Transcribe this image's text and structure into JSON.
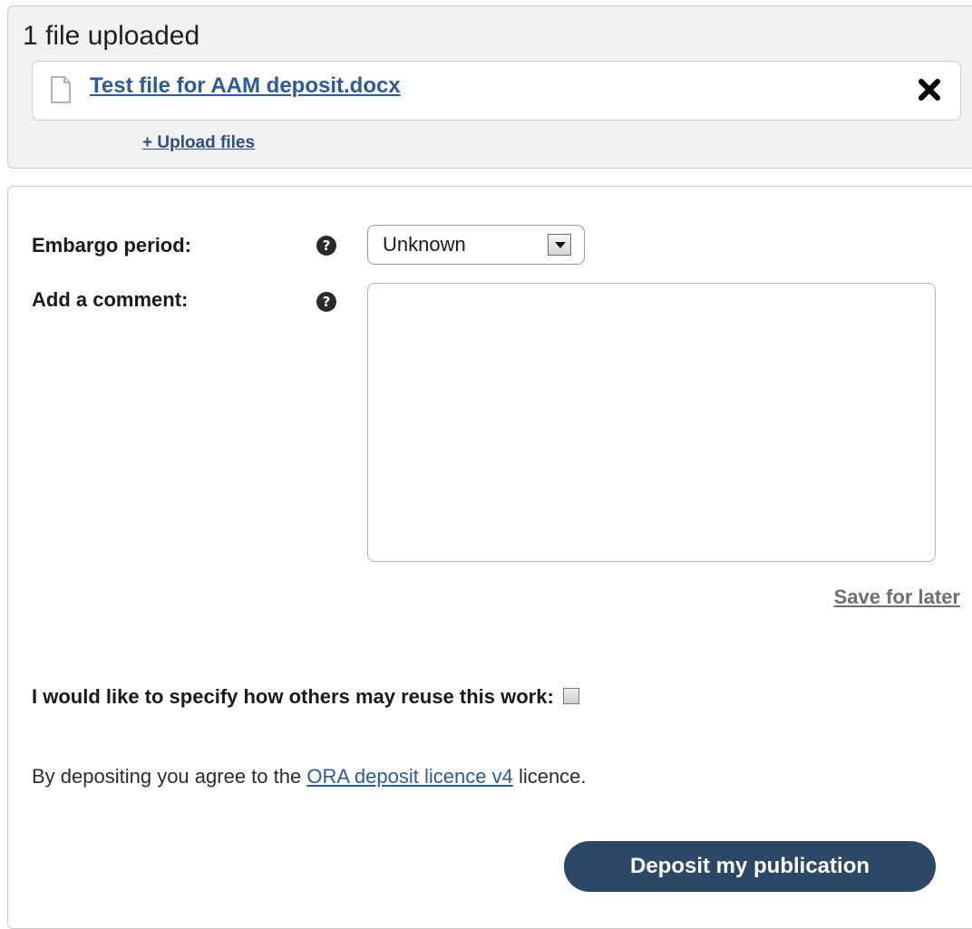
{
  "upload": {
    "title": "1 file uploaded",
    "files": [
      {
        "name": "Test file for AAM deposit.docx",
        "icon": "document-icon",
        "remove_icon": "close-icon"
      }
    ],
    "upload_more_label": "+ Upload files"
  },
  "form": {
    "embargo": {
      "label": "Embargo period:",
      "help_icon": "question-circle-icon",
      "help_glyph": "?",
      "selected_value": "Unknown"
    },
    "comment": {
      "label": "Add a comment:",
      "help_icon": "question-circle-icon",
      "help_glyph": "?",
      "value": ""
    },
    "save_label": "Save for later",
    "reuse": {
      "label": "I would like to specify how others may reuse this work:",
      "checked": false
    },
    "licence": {
      "prefix": "By depositing you agree to the",
      "link_text": "ORA deposit licence v4",
      "suffix": "licence."
    },
    "deposit_label": "Deposit my publication"
  },
  "colors": {
    "link": "#2b5aa0",
    "button": "#2b4866",
    "panel_bg": "#f1f1f1"
  }
}
